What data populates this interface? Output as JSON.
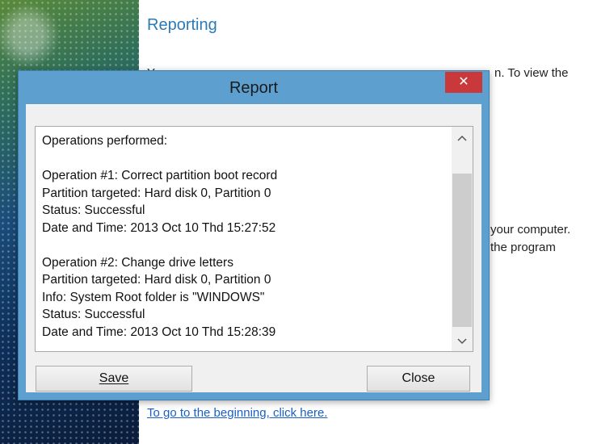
{
  "page": {
    "heading": "Reporting",
    "line1_left": "Y",
    "line1_right": "n. To view the",
    "line2_right": "your computer.",
    "line3_right": "the program",
    "bottom_link": "To go to the beginning, click here."
  },
  "dialog": {
    "title": "Report",
    "close_glyph": "✕",
    "lines": [
      "Operations performed:",
      "",
      "Operation #1: Correct partition boot record",
      "Partition targeted: Hard disk 0, Partition 0",
      "Status: Successful",
      "Date and Time: 2013 Oct 10 Thd 15:27:52",
      "",
      "Operation #2: Change drive letters",
      "Partition targeted: Hard disk 0, Partition 0",
      "Info: System Root folder is \"WINDOWS\"",
      "Status: Successful",
      "Date and Time: 2013 Oct 10 Thd 15:28:39"
    ],
    "save_label": "Save",
    "close_label": "Close"
  },
  "colors": {
    "accent": "#2a7ab8",
    "dialog_frame": "#5da0cf",
    "close_button": "#c9383a",
    "link": "#1a5fc7"
  },
  "icons": {
    "scroll_up": "chevron-up-icon",
    "scroll_down": "chevron-down-icon",
    "close": "close-icon"
  }
}
